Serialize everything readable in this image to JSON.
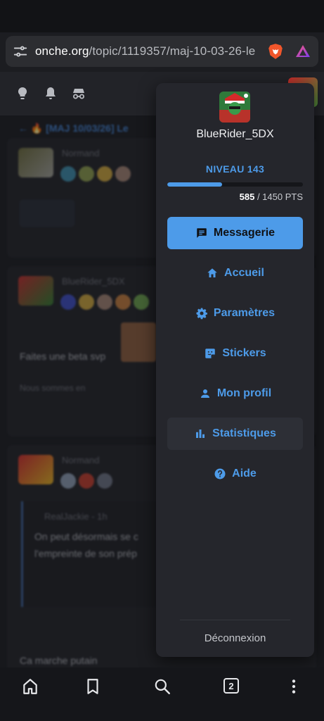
{
  "browser": {
    "url_domain": "onche.org",
    "url_path": "/topic/1119357/maj-10-03-26-le"
  },
  "topic": {
    "title": "[MAJ 10/03/26] Le"
  },
  "posts": [
    {
      "user": "Normand",
      "text": ""
    },
    {
      "user": "BlueRider_5DX",
      "text": "Faites une beta svp",
      "sub": "Nous sommes en"
    },
    {
      "user": "Normand",
      "quote_user": "RealJackie - 1h",
      "quote_text_1": "On peut désormais se c",
      "quote_text_2": "l'empreinte de son prép",
      "text": "Ca marche putain"
    }
  ],
  "menu": {
    "username": "BlueRider_5DX",
    "level_label": "NIVEAU 143",
    "progress_fraction": 0.403,
    "points_current": "585",
    "points_total": " / 1450 PTS",
    "items": [
      {
        "label": "Messagerie",
        "icon": "chat-icon"
      },
      {
        "label": "Accueil",
        "icon": "home-icon"
      },
      {
        "label": "Paramètres",
        "icon": "gear-icon"
      },
      {
        "label": "Stickers",
        "icon": "sticker-icon"
      },
      {
        "label": "Mon profil",
        "icon": "person-icon"
      },
      {
        "label": "Statistiques",
        "icon": "bar-chart-icon"
      },
      {
        "label": "Aide",
        "icon": "help-icon"
      }
    ],
    "logout_label": "Déconnexion"
  },
  "bottom_nav": {
    "tab_count": "2"
  },
  "colors": {
    "accent": "#4d9be9",
    "menu_bg": "#25262c",
    "page_bg": "#17181c"
  }
}
